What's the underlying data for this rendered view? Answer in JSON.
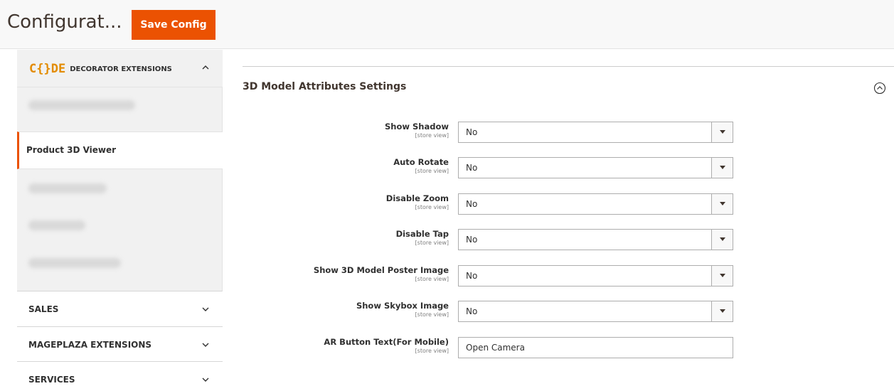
{
  "header": {
    "title": "Configurat...",
    "save_label": "Save Config"
  },
  "sidebar": {
    "extension_group": {
      "logo_code": "C{}DE",
      "logo_text": "DECORATOR EXTENSIONS",
      "active_item": "Product 3D Viewer"
    },
    "groups": [
      {
        "label": "SALES"
      },
      {
        "label": "MAGEPLAZA EXTENSIONS"
      },
      {
        "label": "SERVICES"
      }
    ]
  },
  "main": {
    "section_title": "3D Model Attributes Settings",
    "scope_label": "[store view]",
    "fields": [
      {
        "label": "Show Shadow",
        "value": "No"
      },
      {
        "label": "Auto Rotate",
        "value": "No"
      },
      {
        "label": "Disable Zoom",
        "value": "No"
      },
      {
        "label": "Disable Tap",
        "value": "No"
      },
      {
        "label": "Show 3D Model Poster Image",
        "value": "No"
      },
      {
        "label": "Show Skybox Image",
        "value": "No"
      }
    ],
    "text_field": {
      "label": "AR Button Text(For Mobile)",
      "value": "Open Camera"
    }
  },
  "colors": {
    "accent": "#eb5202",
    "logo": "#e38b00"
  }
}
